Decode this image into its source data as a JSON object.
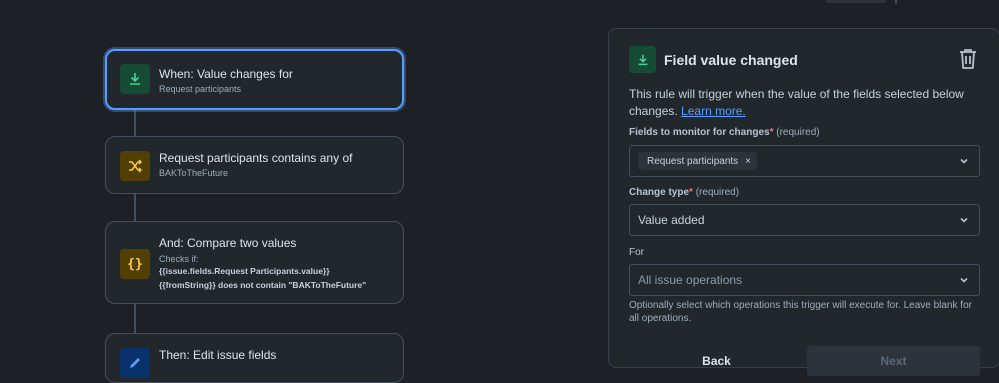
{
  "rule_nodes": [
    {
      "title": "When: Value changes for",
      "subtitle": "Request participants",
      "icon": "trigger-download-icon",
      "color": "#4bce97"
    },
    {
      "title": "Request participants contains any of",
      "subtitle": "BAKToTheFuture",
      "icon": "branch-shuffle-icon",
      "color": "#f5cd47"
    },
    {
      "title": "And: Compare two values",
      "subtitle": "Checks if:",
      "code_line1": "{{issue.fields.Request Participants.value}}",
      "code_line2": "{{fromString}} does not contain \"BAKToTheFuture\"",
      "icon": "braces-icon",
      "color": "#f5cd47"
    },
    {
      "title": "Then: Edit issue fields",
      "icon": "pencil-icon",
      "color": "#579dff"
    }
  ],
  "panel": {
    "title": "Field value changed",
    "description": "This rule will trigger when the value of the fields selected below changes.",
    "learn_more": "Learn more.",
    "fields_label": "Fields to monitor for changes",
    "required_star": "*",
    "required_text": "(required)",
    "fields_tag": "Request participants",
    "tag_remove": "×",
    "change_type_label": "Change type",
    "change_type_value": "Value added",
    "for_label": "For",
    "for_placeholder": "All issue operations",
    "help_text": "Optionally select which operations this trigger will execute for. Leave blank for all operations.",
    "back_label": "Back",
    "next_label": "Next"
  },
  "colors": {
    "accent": "#579dff",
    "background": "#1d2125",
    "danger": "#f87168"
  }
}
